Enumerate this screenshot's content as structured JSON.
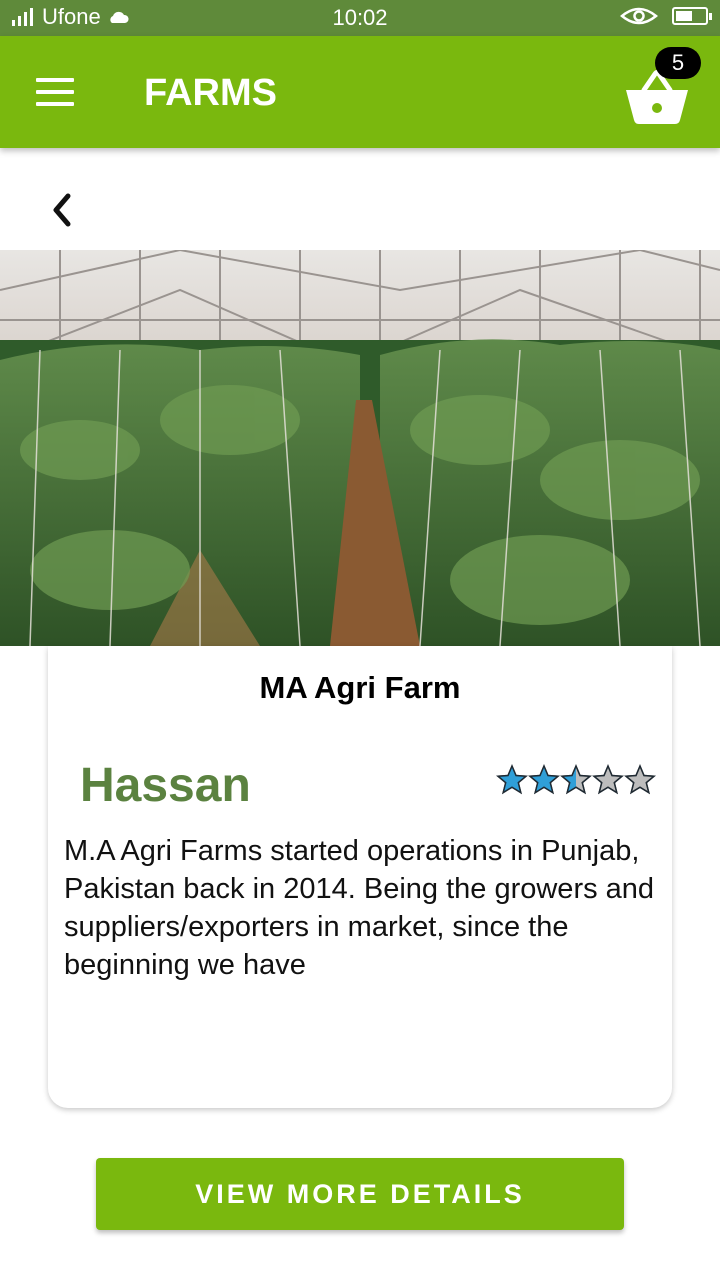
{
  "status_bar": {
    "carrier": "Ufone",
    "time": "10:02"
  },
  "app_bar": {
    "title": "FARMS",
    "cart_count": "5"
  },
  "farm": {
    "name": "MA Agri Farm",
    "owner": "Hassan",
    "rating": 2.5,
    "rating_max": 5,
    "description": "M.A Agri Farms started operations in Punjab, Pakistan back in 2014. Being the growers and suppliers/exporters in market, since the beginning we have"
  },
  "actions": {
    "view_more_label": "VIEW MORE DETAILS"
  },
  "colors": {
    "primary": "#7ab80e",
    "owner_text": "#5b8240",
    "star_filled": "#2f9fd8",
    "star_empty": "#bdbdbd"
  },
  "icons": [
    "signal-icon",
    "cloud-icon",
    "eye-icon",
    "battery-icon",
    "menu-icon",
    "cart-icon",
    "back-arrow-icon",
    "star-icon"
  ]
}
